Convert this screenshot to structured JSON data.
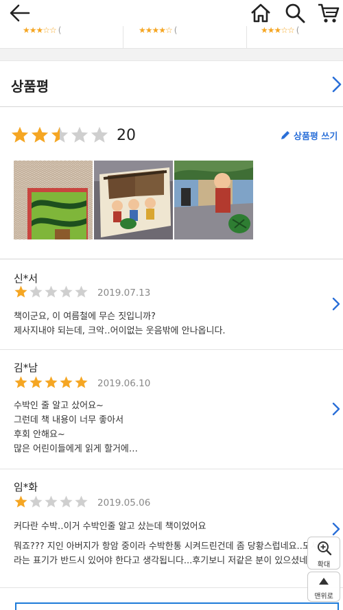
{
  "header": {
    "back_icon": "arrow-left-icon",
    "home_icon": "home-icon",
    "search_icon": "search-icon",
    "cart_icon": "cart-icon"
  },
  "review_section": {
    "title": "상품평",
    "summary": {
      "rating": 2.5,
      "rating_max": 5,
      "count": "20",
      "write_label": "상품평 쓰기"
    },
    "reviews": [
      {
        "author": "신*서",
        "rating": 1,
        "date": "2019.07.13",
        "lines": [
          "책이군요, 이 여름철에 무슨 짓입니까?",
          "제사지내야 되는데, 크악‥어이없는 웃음밖에 안나옵니다."
        ]
      },
      {
        "author": "김*남",
        "rating": 5,
        "date": "2019.06.10",
        "lines": [
          "수박인 줄 알고 샀어요~",
          "그런데 책 내용이 너무 좋아서",
          "후회 안해요~",
          "많은 어린이들에게 읽게 할거에…"
        ]
      },
      {
        "author": "임*화",
        "rating": 1,
        "date": "2019.05.06",
        "lines": [
          "커다란 수박‥이거 수박인줄 알고 샀는데 책이었어요",
          "",
          "뭐죠??? 지인 아버지가 항암 중이라 수박한통 시켜드린건데 좀 당황스럽네요..도서",
          "라는 표기가 반드시 있어야 한다고 생각됩니다...후기보니 저같은 분이 있으셨네"
        ]
      }
    ]
  },
  "floating": {
    "zoom_label": "확대",
    "top_label": "맨위로"
  },
  "colors": {
    "star": "#f5a623",
    "star_empty": "#cfcfcf",
    "accent": "#2a6fd8"
  }
}
